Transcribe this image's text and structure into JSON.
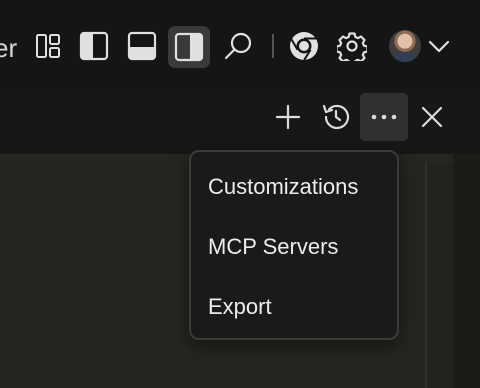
{
  "titlebar": {
    "partial_text": "er",
    "icons": [
      "customize-layout-icon",
      "toggle-primary-sidebar-icon",
      "toggle-panel-icon",
      "toggle-secondary-sidebar-icon",
      "search-icon",
      "chrome-icon",
      "settings-gear-icon",
      "account-avatar",
      "chevron-down-icon"
    ]
  },
  "panel_header": {
    "icons": [
      "add-icon",
      "history-icon",
      "more-actions-icon",
      "close-icon"
    ]
  },
  "menu": {
    "items": [
      {
        "label": "Customizations"
      },
      {
        "label": "MCP Servers"
      },
      {
        "label": "Export"
      }
    ]
  },
  "colors": {
    "titlebar_bg": "#151515",
    "editor_bg": "#25261f",
    "menu_bg": "#1a1a1a",
    "menu_border": "#3b3b3b"
  }
}
